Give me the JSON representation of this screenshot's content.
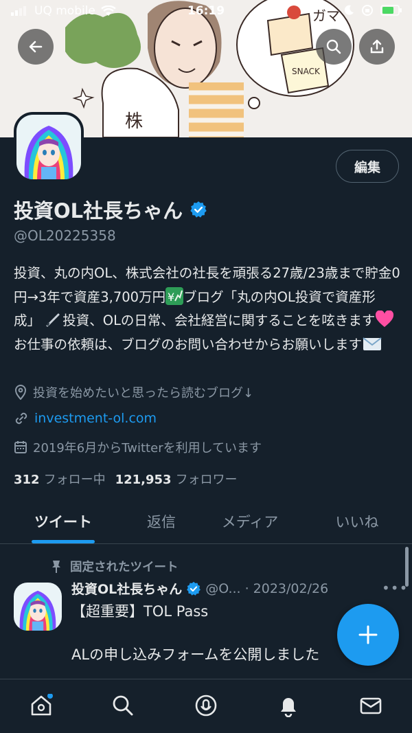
{
  "status_bar": {
    "carrier": "UQ mobile",
    "time": "16:19"
  },
  "header": {
    "back_icon": "arrow-left-icon",
    "search_icon": "search-icon",
    "share_icon": "share-icon"
  },
  "profile": {
    "edit_label": "編集",
    "name": "投資OL社長ちゃん",
    "verified": true,
    "handle": "@OL20225358",
    "bio_parts": {
      "p1": "投資、丸の内OL、株式会社の社長を頑張る27歳/23歳まで貯金0円→3年で資産3,700万円",
      "p2": "ブログ「丸の内OL投資で資産形成」",
      "p3": "投資、OLの日常、会社経営に関することを呟きます",
      "p4": "お仕事の依頼は、ブログのお問い合わせからお願いします"
    },
    "location": "投資を始めたいと思ったら読むブログ↓",
    "website": "investment-ol.com",
    "joined": "2019年6月からTwitterを利用しています",
    "following_count": "312",
    "following_label": "フォロー中",
    "followers_count": "121,953",
    "followers_label": "フォロワー"
  },
  "tabs": [
    {
      "label": "ツイート",
      "active": true
    },
    {
      "label": "返信",
      "active": false
    },
    {
      "label": "メディア",
      "active": false
    },
    {
      "label": "いいね",
      "active": false
    }
  ],
  "pinned_tweet": {
    "pinned_label": "固定されたツイート",
    "author": "投資OL社長ちゃん",
    "handle": "@O...",
    "date": "· 2023/02/26",
    "line1": "【超重要】TOL Pass",
    "line2": "ALの申し込みフォームを公開しました"
  },
  "colors": {
    "background": "#15202b",
    "accent": "#1d9bf0",
    "muted": "#8b98a5"
  },
  "bottom_nav": [
    "home-icon",
    "search-icon",
    "spaces-icon",
    "notifications-icon",
    "messages-icon"
  ]
}
